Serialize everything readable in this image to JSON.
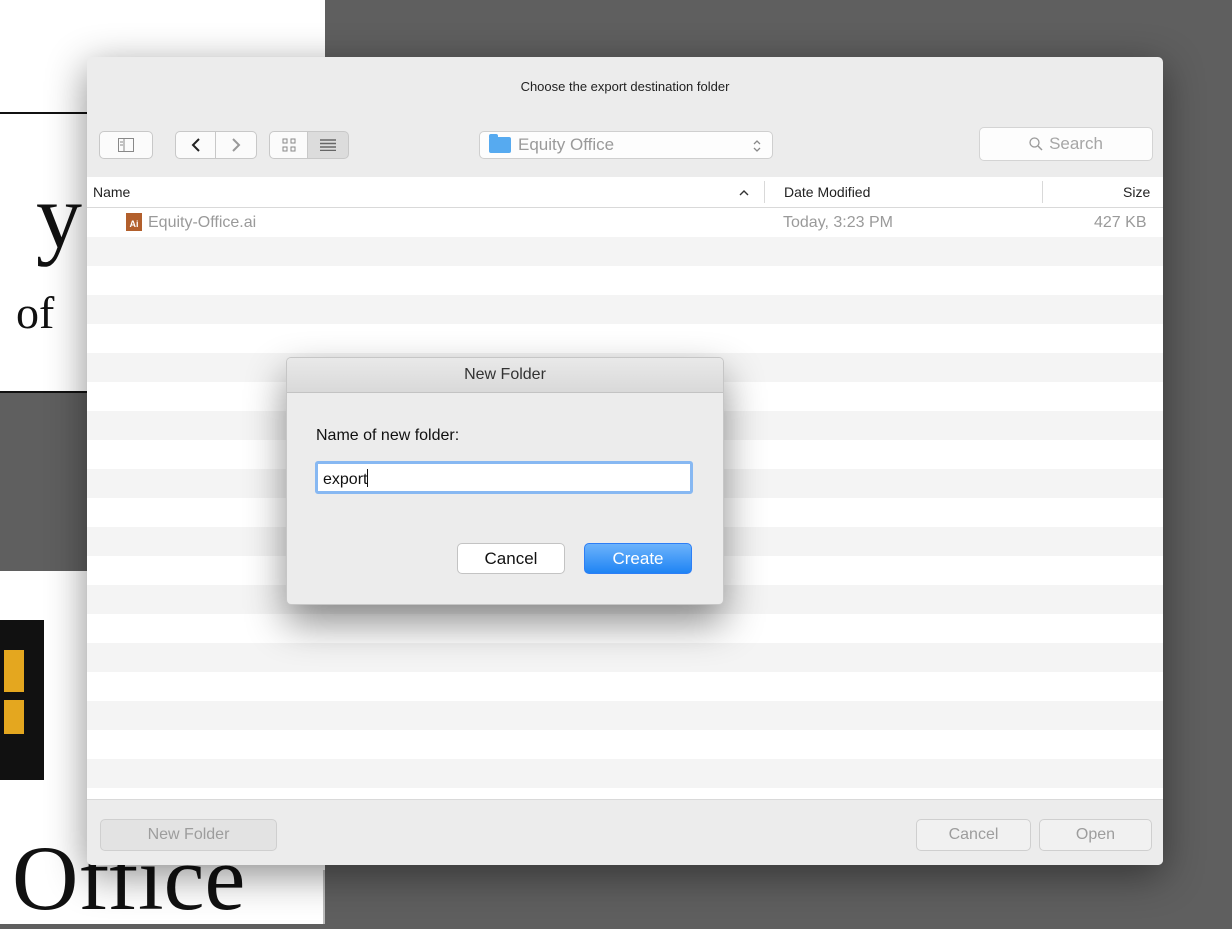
{
  "background_doc": {
    "text_y": "y",
    "text_of": "of",
    "text_office": "Office"
  },
  "panel": {
    "title": "Choose the export destination folder",
    "location": "Equity Office",
    "search_placeholder": "Search",
    "columns": {
      "name": "Name",
      "date_modified": "Date Modified",
      "size": "Size"
    },
    "files": [
      {
        "name": "Equity-Office.ai",
        "date": "Today, 3:23 PM",
        "size": "427 KB",
        "icon": "ai-file-icon",
        "icon_label": "Ai"
      }
    ],
    "new_folder_label": "New Folder",
    "cancel_label": "Cancel",
    "open_label": "Open"
  },
  "new_folder_dialog": {
    "title": "New Folder",
    "prompt": "Name of new folder:",
    "value": "export",
    "cancel_label": "Cancel",
    "create_label": "Create"
  },
  "colors": {
    "accent": "#1f84f4",
    "folder": "#56aaf0",
    "ai_icon": "#b25f2c",
    "backdrop": "#5f5f5f"
  }
}
